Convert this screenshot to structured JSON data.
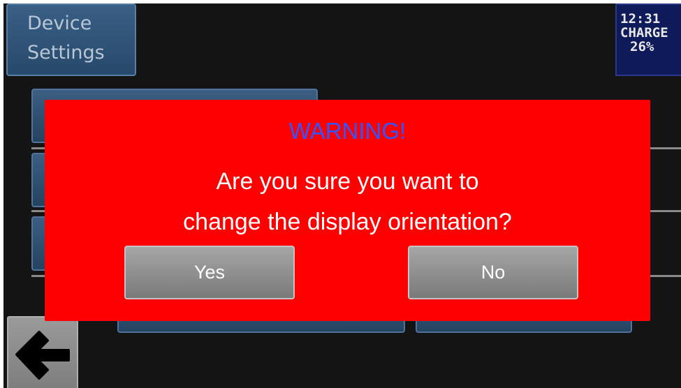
{
  "header": {
    "title_line1": "Device",
    "title_line2": "Settings"
  },
  "status": {
    "time": "12:31",
    "charge_label": "CHARGE",
    "charge_percent": "26%"
  },
  "dialog": {
    "title": "WARNING!",
    "message_line1": "Are you sure you want to",
    "message_line2": "change the display orientation?",
    "yes_label": "Yes",
    "no_label": "No"
  },
  "navigation": {
    "back_icon": "arrow-left-icon"
  },
  "colors": {
    "background": "#141414",
    "dialog": "#ff0000",
    "dialog_title": "#3355ff",
    "button_blue": "#27496b",
    "status_bg": "#0f1a5a"
  }
}
